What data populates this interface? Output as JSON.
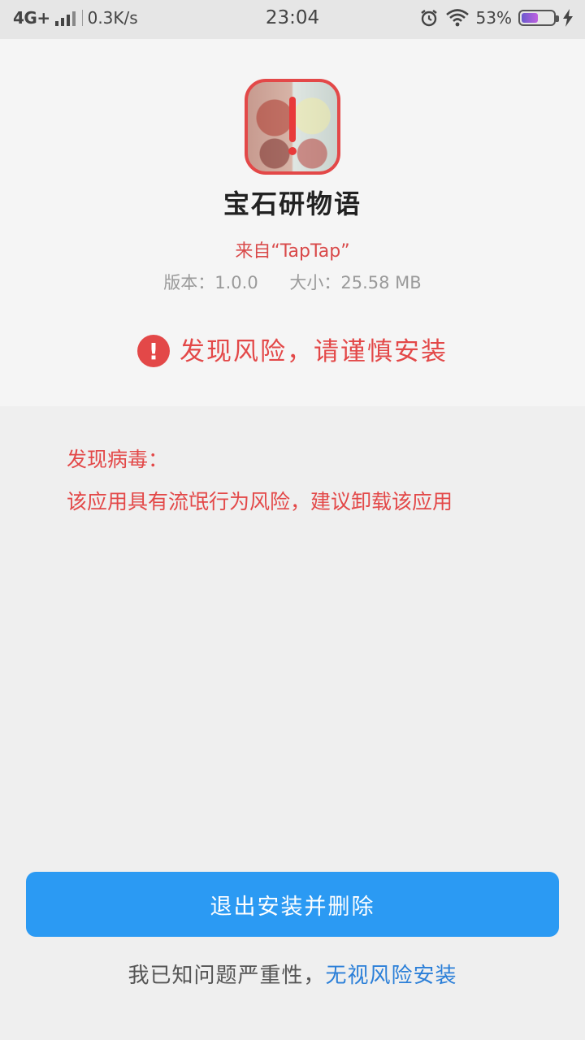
{
  "status_bar": {
    "network": "4G+",
    "speed": "0.3K/s",
    "time": "23:04",
    "battery_pct": "53%",
    "battery_level": 0.53,
    "icons": [
      "signal-icon",
      "alarm-icon",
      "wifi-icon",
      "battery-icon",
      "charging-icon"
    ]
  },
  "app": {
    "name": "宝石研物语",
    "source": "来自“TapTap”",
    "version": "版本：1.0.0",
    "size": "大小：25.58 MB"
  },
  "warning": {
    "icon": "!",
    "text": "发现风险，请谨慎安装"
  },
  "virus": {
    "title": "发现病毒：",
    "description": "该应用具有流氓行为风险，建议卸载该应用"
  },
  "actions": {
    "exit_delete_label": "退出安装并删除",
    "ignore_prefix": "我已知问题严重性，",
    "ignore_link": "无视风险安装"
  },
  "colors": {
    "danger": "#e34848",
    "primary": "#2b9af3",
    "link": "#2b7fd8"
  }
}
